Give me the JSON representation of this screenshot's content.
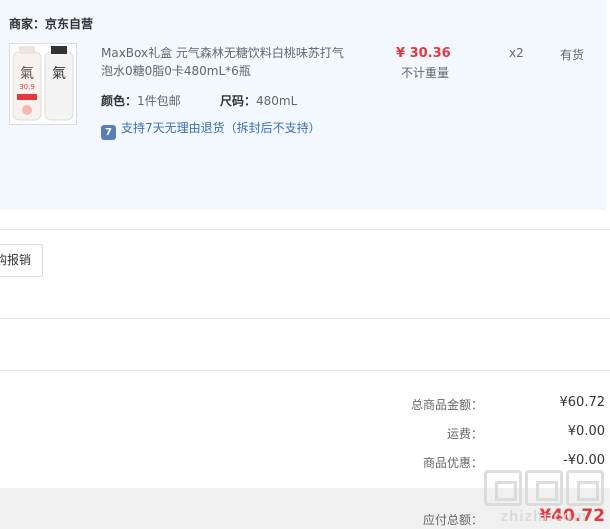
{
  "merchant": {
    "label": "商家：",
    "name": "京东自营"
  },
  "product": {
    "image_badge": "30.9",
    "image_char": "氣",
    "title": "MaxBox礼盒 元气森林无糖饮料白桃味苏打气泡水0糖0脂0卡480mL*6瓶",
    "price": "¥ 30.36",
    "weight_note": "不计重量",
    "quantity": "x2",
    "stock": "有货",
    "color_label": "颜色：",
    "color_value": "1件包邮",
    "size_label": "尺码：",
    "size_value": "480mL",
    "return_icon": "7",
    "return_policy": "支持7天无理由退货（拆封后不支持）"
  },
  "reimbursement_button": "购报销",
  "summary": {
    "items_label": "总商品金额：",
    "items_value": "¥60.72",
    "shipping_label": "运费：",
    "shipping_value": "¥0.00",
    "discount_label": "商品优惠：",
    "discount_value": "-¥0.00"
  },
  "total": {
    "label": "应付总额：",
    "value": "¥40.72"
  },
  "watermark": {
    "text": "zhizhi.com"
  },
  "colors": {
    "price_red": "#e4393c",
    "panel_bg": "#f3f8fe",
    "link_blue": "#3a6fb7"
  }
}
